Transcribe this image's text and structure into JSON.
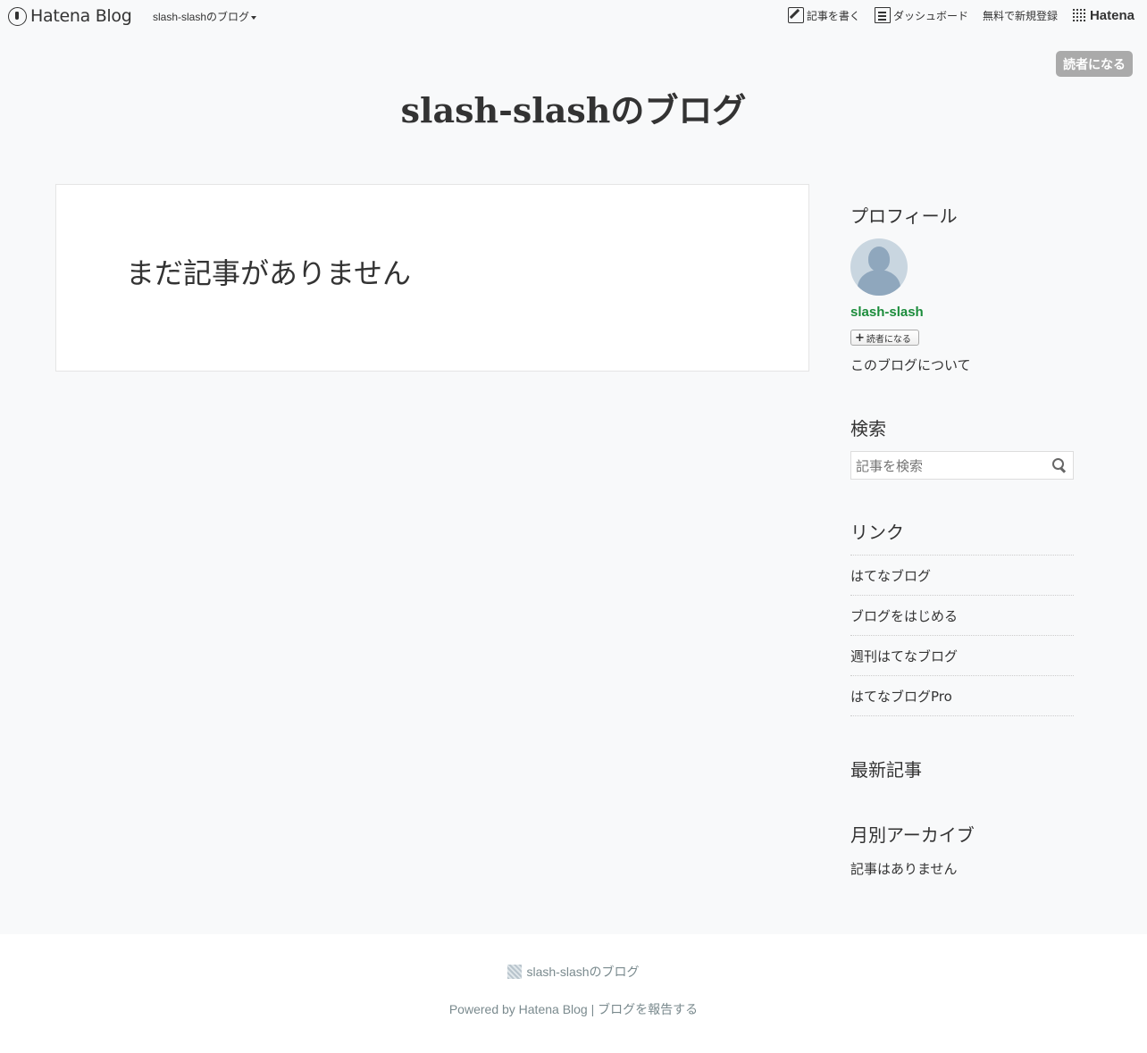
{
  "header": {
    "logo_text": "Hatena Blog",
    "blog_menu": "slash-slashのブログ",
    "write_label": "記事を書く",
    "dashboard_label": "ダッシュボード",
    "signup_label": "無料で新規登録",
    "hatena_label": "Hatena",
    "subscribe_label": "読者になる"
  },
  "blog": {
    "title": "slash-slashのブログ"
  },
  "main": {
    "no_entry": "まだ記事がありません"
  },
  "sidebar": {
    "profile": {
      "title": "プロフィール",
      "name": "slash-slash",
      "subscribe": "読者になる",
      "about": "このブログについて"
    },
    "search": {
      "title": "検索",
      "placeholder": "記事を検索"
    },
    "links": {
      "title": "リンク",
      "items": [
        "はてなブログ",
        "ブログをはじめる",
        "週刊はてなブログ",
        "はてなブログPro"
      ]
    },
    "recent": {
      "title": "最新記事"
    },
    "archive": {
      "title": "月別アーカイブ",
      "empty": "記事はありません"
    }
  },
  "footer": {
    "blog_name": "slash-slashのブログ",
    "powered": "Powered by Hatena Blog",
    "separator": "|",
    "report": "ブログを報告する"
  }
}
